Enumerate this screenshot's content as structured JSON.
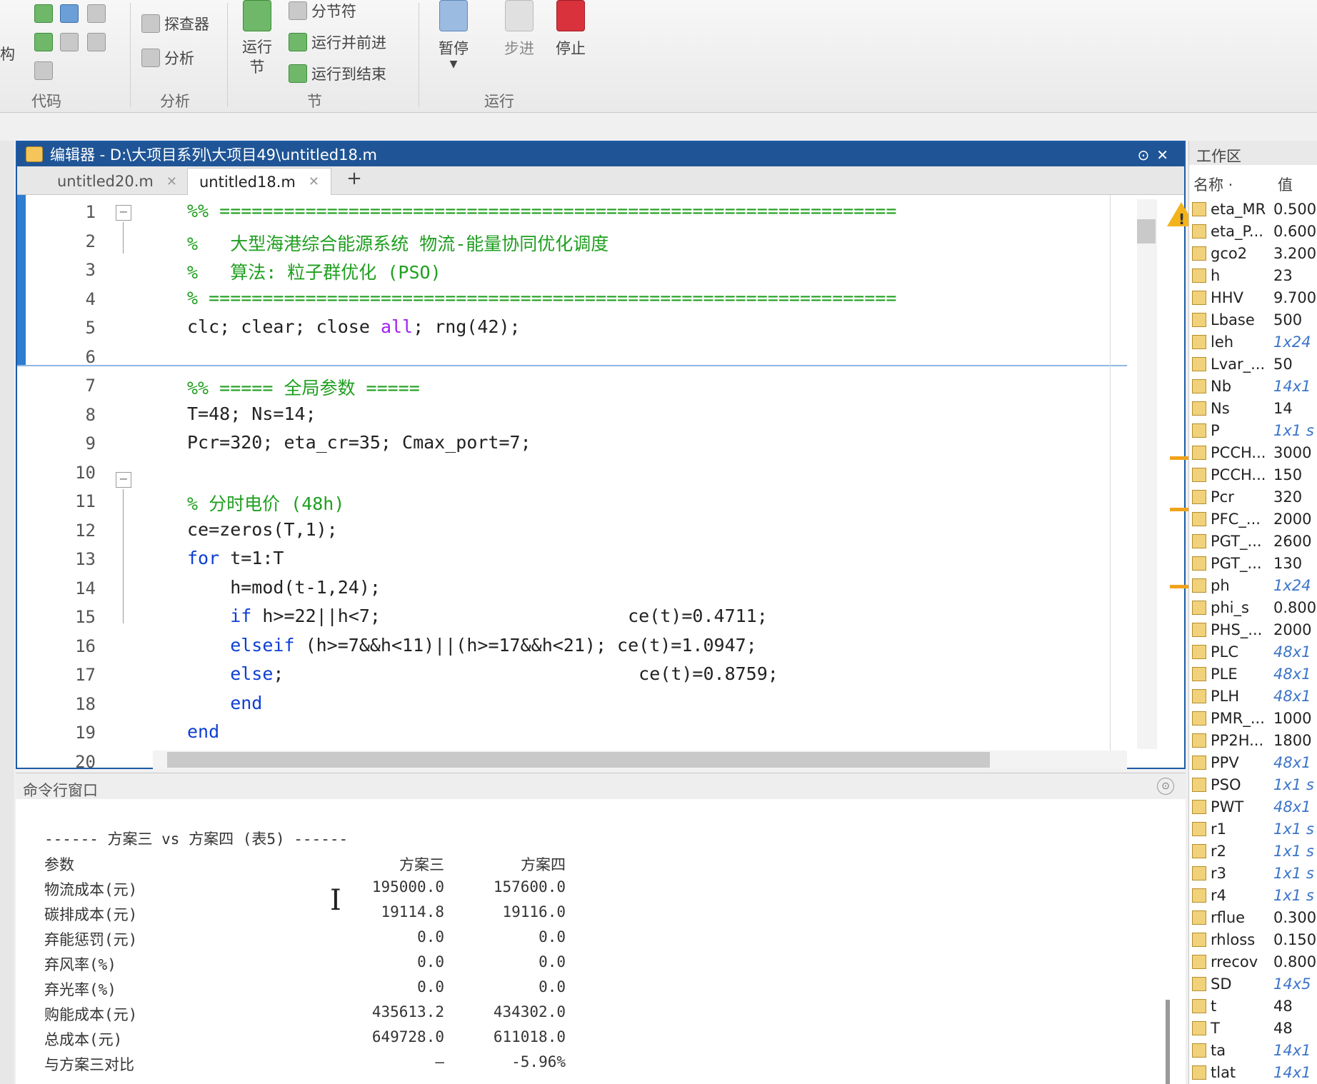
{
  "toolstrip": {
    "groups": [
      {
        "label": "代码"
      },
      {
        "label": "分析"
      },
      {
        "label": "节"
      },
      {
        "label": "运行"
      }
    ],
    "left_partial_labels": [
      "构"
    ],
    "buttons": {
      "explorer": "探查器",
      "analyze": "分析",
      "run_section": "运行\n节",
      "section_break": "分节符",
      "run_and_advance": "运行并前进",
      "run_to_end": "运行到结束",
      "pause": "暂停",
      "step": "步进",
      "stop": "停止"
    }
  },
  "editor": {
    "title": "编辑器 - D:\\大项目系列\\大项目49\\untitled18.m",
    "tabs": [
      {
        "label": "untitled20.m",
        "active": false
      },
      {
        "label": "untitled18.m",
        "active": true
      }
    ],
    "add_tab": "+",
    "lines": [
      {
        "n": "1",
        "segs": [
          {
            "c": "green",
            "t": "%% ==============================================================="
          }
        ]
      },
      {
        "n": "2",
        "segs": [
          {
            "c": "green",
            "t": "%   大型海港综合能源系统 物流-能量协同优化调度"
          }
        ]
      },
      {
        "n": "3",
        "segs": [
          {
            "c": "green",
            "t": "%   算法: 粒子群优化 (PSO)"
          }
        ]
      },
      {
        "n": "4",
        "segs": [
          {
            "c": "green",
            "t": "% ================================================================"
          }
        ]
      },
      {
        "n": "5",
        "segs": [
          {
            "c": "",
            "t": "clc; clear; close "
          },
          {
            "c": "purple",
            "t": "all"
          },
          {
            "c": "",
            "t": "; rng(42);"
          }
        ]
      },
      {
        "n": "6",
        "segs": []
      },
      {
        "n": "7",
        "segs": [
          {
            "c": "green",
            "t": "%% ===== 全局参数 ====="
          }
        ]
      },
      {
        "n": "8",
        "segs": [
          {
            "c": "",
            "t": "T=48; Ns=14;"
          }
        ]
      },
      {
        "n": "9",
        "segs": [
          {
            "c": "",
            "t": "Pcr=320; eta_cr=35; Cmax_port=7;"
          }
        ]
      },
      {
        "n": "10",
        "segs": []
      },
      {
        "n": "11",
        "segs": [
          {
            "c": "green",
            "t": "% 分时电价 (48h)"
          }
        ]
      },
      {
        "n": "12",
        "segs": [
          {
            "c": "",
            "t": "ce=zeros(T,1);"
          }
        ]
      },
      {
        "n": "13",
        "segs": [
          {
            "c": "blue",
            "t": "for"
          },
          {
            "c": "",
            "t": " t=1:T"
          }
        ]
      },
      {
        "n": "14",
        "segs": [
          {
            "c": "",
            "t": "    h=mod(t-1,24);"
          }
        ]
      },
      {
        "n": "15",
        "segs": [
          {
            "c": "blue",
            "t": "    if"
          },
          {
            "c": "",
            "t": " h>=22||h<7;                       ce(t)=0.4711;"
          }
        ]
      },
      {
        "n": "16",
        "segs": [
          {
            "c": "blue",
            "t": "    elseif"
          },
          {
            "c": "",
            "t": " (h>=7&&h<11)||(h>=17&&h<21); ce(t)=1.0947;"
          }
        ]
      },
      {
        "n": "17",
        "segs": [
          {
            "c": "blue",
            "t": "    else"
          },
          {
            "c": "",
            "t": ";                                 ce(t)=0.8759;"
          }
        ]
      },
      {
        "n": "18",
        "segs": [
          {
            "c": "blue",
            "t": "    end"
          }
        ]
      },
      {
        "n": "19",
        "segs": [
          {
            "c": "blue",
            "t": "end"
          }
        ]
      },
      {
        "n": "20",
        "segs": []
      }
    ]
  },
  "command_window": {
    "title": "命令行窗口",
    "heading": "------ 方案三 vs 方案四 (表5) ------",
    "columns": [
      "参数",
      "方案三",
      "方案四"
    ],
    "rows": [
      [
        "物流成本(元)",
        "195000.0",
        "157600.0"
      ],
      [
        "碳排成本(元)",
        "19114.8",
        "19116.0"
      ],
      [
        "弃能惩罚(元)",
        "0.0",
        "0.0"
      ],
      [
        "弃风率(%)",
        "0.0",
        "0.0"
      ],
      [
        "弃光率(%)",
        "0.0",
        "0.0"
      ],
      [
        "购能成本(元)",
        "435613.2",
        "434302.0"
      ],
      [
        "总成本(元)",
        "649728.0",
        "611018.0"
      ],
      [
        "与方案三对比",
        "—",
        "-5.96%"
      ]
    ]
  },
  "workspace": {
    "title": "工作区",
    "header_name": "名称 ·",
    "header_value": "值",
    "vars": [
      {
        "name": "eta_MR",
        "value": "0.500",
        "dim": false
      },
      {
        "name": "eta_P...",
        "value": "0.600",
        "dim": false
      },
      {
        "name": "gco2",
        "value": "3.200",
        "dim": false
      },
      {
        "name": "h",
        "value": "23",
        "dim": false
      },
      {
        "name": "HHV",
        "value": "9.700",
        "dim": false
      },
      {
        "name": "Lbase",
        "value": "500",
        "dim": false
      },
      {
        "name": "leh",
        "value": "1x24",
        "dim": true
      },
      {
        "name": "Lvar_...",
        "value": "50",
        "dim": false
      },
      {
        "name": "Nb",
        "value": "14x1",
        "dim": true
      },
      {
        "name": "Ns",
        "value": "14",
        "dim": false
      },
      {
        "name": "P",
        "value": "1x1 s",
        "dim": true
      },
      {
        "name": "PCCH...",
        "value": "3000",
        "dim": false
      },
      {
        "name": "PCCH...",
        "value": "150",
        "dim": false
      },
      {
        "name": "Pcr",
        "value": "320",
        "dim": false
      },
      {
        "name": "PFC_...",
        "value": "2000",
        "dim": false
      },
      {
        "name": "PGT_...",
        "value": "2600",
        "dim": false
      },
      {
        "name": "PGT_...",
        "value": "130",
        "dim": false
      },
      {
        "name": "ph",
        "value": "1x24",
        "dim": true
      },
      {
        "name": "phi_s",
        "value": "0.800",
        "dim": false
      },
      {
        "name": "PHS_...",
        "value": "2000",
        "dim": false
      },
      {
        "name": "PLC",
        "value": "48x1",
        "dim": true
      },
      {
        "name": "PLE",
        "value": "48x1",
        "dim": true
      },
      {
        "name": "PLH",
        "value": "48x1",
        "dim": true
      },
      {
        "name": "PMR_...",
        "value": "1000",
        "dim": false
      },
      {
        "name": "PP2H...",
        "value": "1800",
        "dim": false
      },
      {
        "name": "PPV",
        "value": "48x1",
        "dim": true
      },
      {
        "name": "PSO",
        "value": "1x1 s",
        "dim": true
      },
      {
        "name": "PWT",
        "value": "48x1",
        "dim": true
      },
      {
        "name": "r1",
        "value": "1x1 s",
        "dim": true
      },
      {
        "name": "r2",
        "value": "1x1 s",
        "dim": true
      },
      {
        "name": "r3",
        "value": "1x1 s",
        "dim": true
      },
      {
        "name": "r4",
        "value": "1x1 s",
        "dim": true
      },
      {
        "name": "rflue",
        "value": "0.300",
        "dim": false
      },
      {
        "name": "rhloss",
        "value": "0.150",
        "dim": false
      },
      {
        "name": "rrecov",
        "value": "0.800",
        "dim": false
      },
      {
        "name": "SD",
        "value": "14x5",
        "dim": true
      },
      {
        "name": "t",
        "value": "48",
        "dim": false
      },
      {
        "name": "T",
        "value": "48",
        "dim": false
      },
      {
        "name": "ta",
        "value": "14x1",
        "dim": true
      },
      {
        "name": "tlat",
        "value": "14x1",
        "dim": true
      }
    ]
  }
}
